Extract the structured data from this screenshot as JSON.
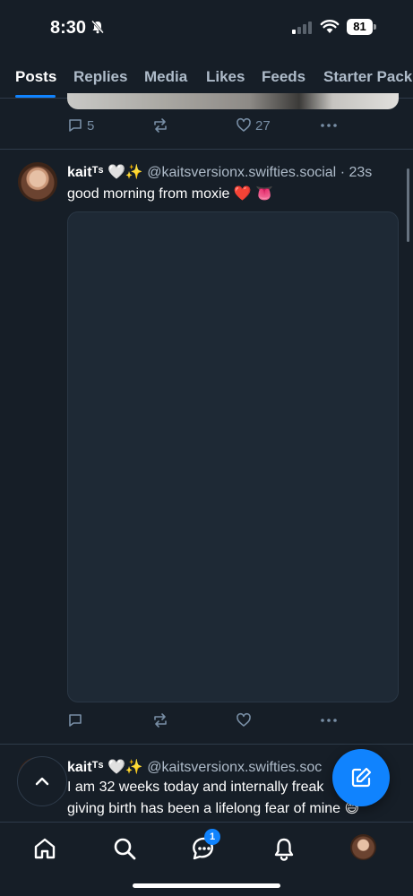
{
  "status_bar": {
    "time": "8:30",
    "battery": "81"
  },
  "tabs": [
    "Posts",
    "Replies",
    "Media",
    "Likes",
    "Feeds",
    "Starter Packs"
  ],
  "active_tab": "Posts",
  "previous_post": {
    "replies": "5",
    "reposts": "",
    "likes": "27"
  },
  "posts": [
    {
      "display_name": "kaitᵀˢ 🤍✨",
      "handle": "@kaitsversionx.swifties.social",
      "separator": "·",
      "time": "23s",
      "text": "good morning from moxie ❤️ 👅"
    },
    {
      "display_name": "kaitᵀˢ 🤍✨",
      "handle": "@kaitsversionx.swifties.soc",
      "line1": "I am 32 weeks today and internally freak",
      "line2": "giving birth has been a lifelong fear of mine 😅"
    }
  ],
  "bottom_nav": {
    "chat_badge": "1"
  },
  "colors": {
    "accent": "#1083fe",
    "background": "#161e27",
    "muted": "#788ea5"
  }
}
